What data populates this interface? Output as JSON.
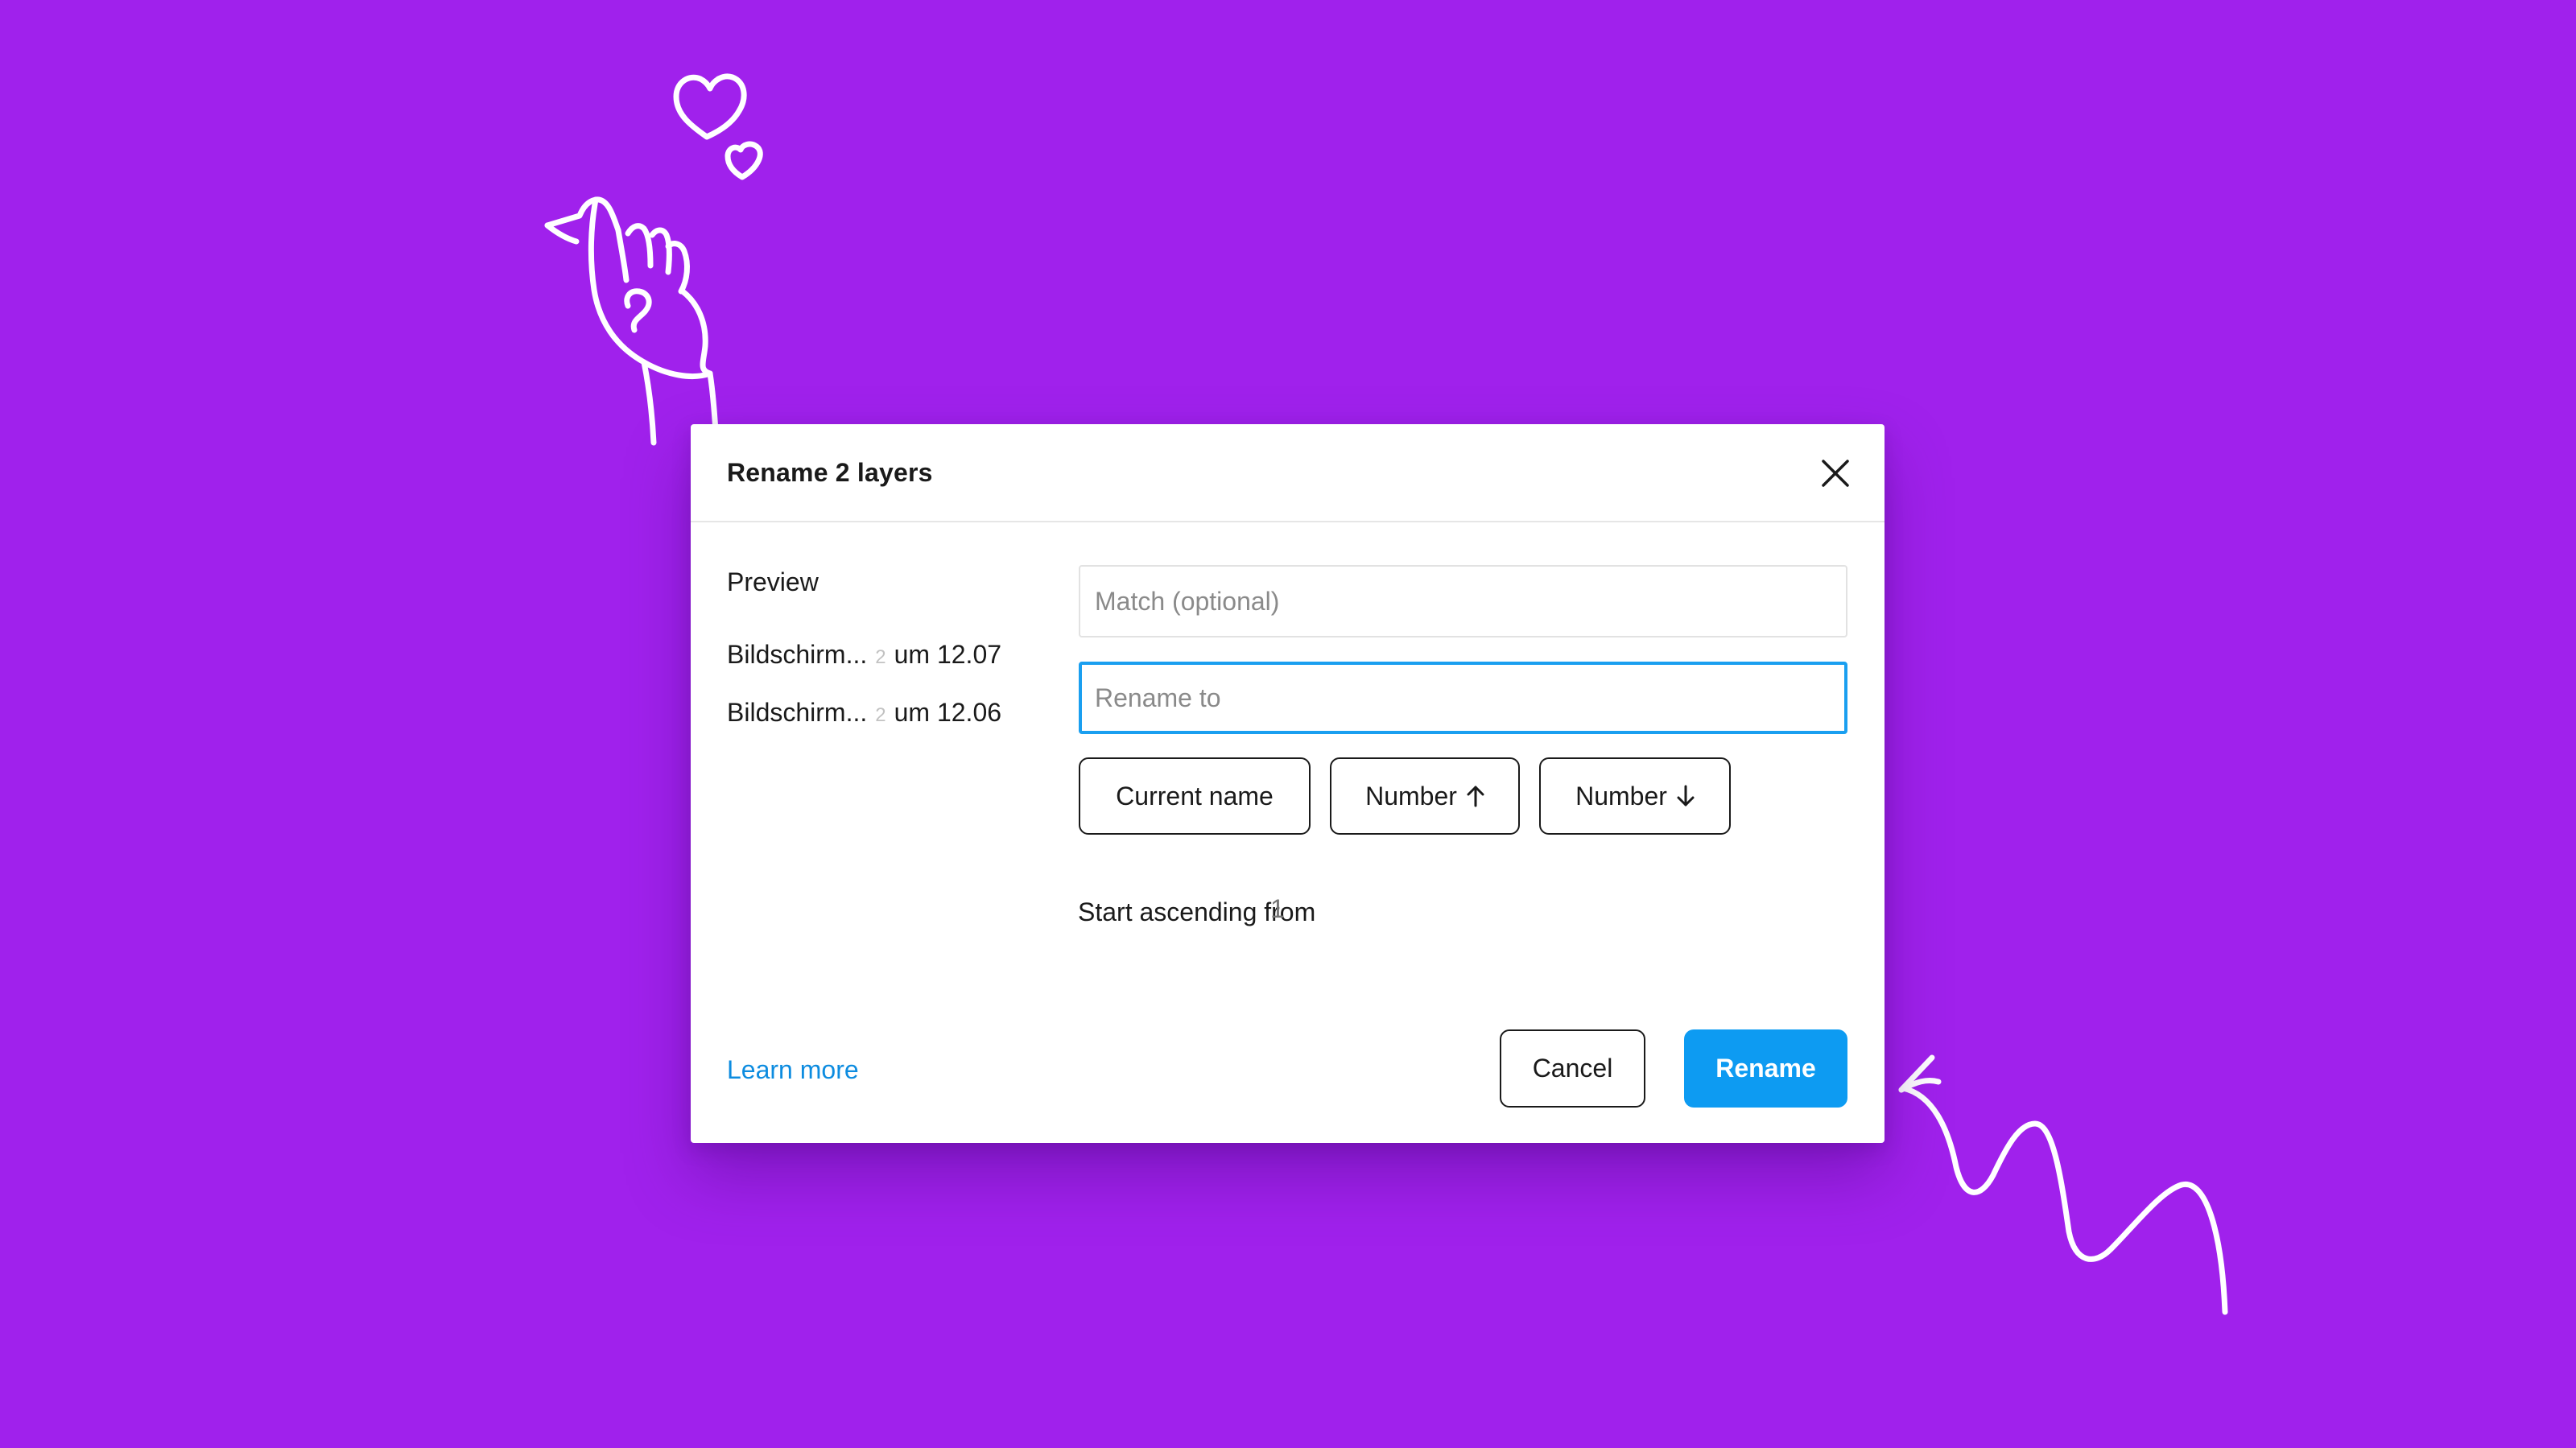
{
  "colors": {
    "background": "#a021ec",
    "dialog_bg": "#ffffff",
    "accent_blue": "#0d9bf2",
    "focus_border": "#1a9ff0",
    "link": "#0d8ce0"
  },
  "dialog": {
    "title": "Rename 2 layers",
    "close_icon": "close-icon"
  },
  "preview": {
    "label": "Preview",
    "items": [
      {
        "name": "Bildschirm...",
        "separator": "2",
        "suffix": "um 12.07"
      },
      {
        "name": "Bildschirm...",
        "separator": "2",
        "suffix": "um 12.06"
      }
    ]
  },
  "fields": {
    "match_placeholder": "Match (optional)",
    "match_value": "",
    "rename_placeholder": "Rename to",
    "rename_value": ""
  },
  "tokens": [
    {
      "label": "Current name",
      "icon": ""
    },
    {
      "label": "Number",
      "icon": "arrow-up-icon"
    },
    {
      "label": "Number",
      "icon": "arrow-down-icon"
    }
  ],
  "start": {
    "label": "Start ascending from",
    "placeholder": "1"
  },
  "footer": {
    "learn_more": "Learn more",
    "cancel": "Cancel",
    "rename": "Rename"
  },
  "decorations": [
    "hand-heart-doodle",
    "squiggle-arrow-doodle"
  ]
}
